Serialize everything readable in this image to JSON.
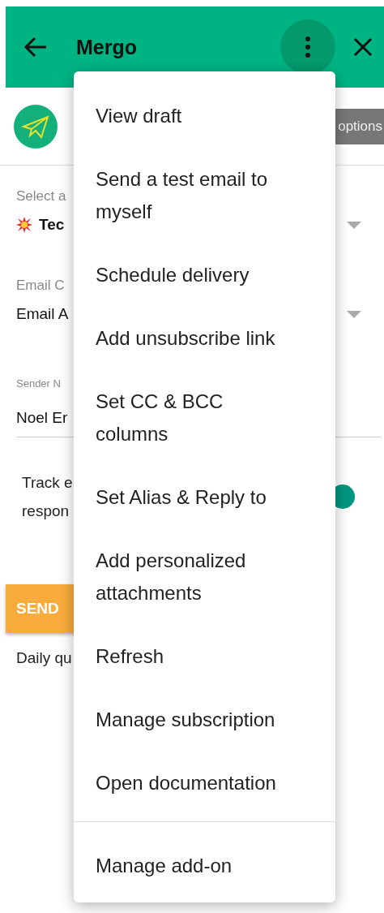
{
  "header": {
    "title": "Mergo"
  },
  "options_button": {
    "label": "options"
  },
  "fields": [
    {
      "kind": "select",
      "label": "Select a",
      "value": "Tec",
      "bold": true
    },
    {
      "kind": "select",
      "label": "Email C",
      "value": "Email A",
      "bold": false
    },
    {
      "kind": "text",
      "label": "Sender N",
      "value": "Noel Er",
      "bold": false
    }
  ],
  "tracking": {
    "lines": [
      "Track e",
      "respon"
    ],
    "on": true
  },
  "send_button": {
    "label": "SEND"
  },
  "quota_text": "Daily qu",
  "menu": {
    "items": [
      {
        "label": "View draft",
        "divider_before": false
      },
      {
        "label": "Send a test email to myself",
        "divider_before": false
      },
      {
        "label": "Schedule delivery",
        "divider_before": false
      },
      {
        "label": "Add unsubscribe link",
        "divider_before": false
      },
      {
        "label": "Set CC & BCC columns",
        "divider_before": false
      },
      {
        "label": "Set Alias & Reply to",
        "divider_before": false
      },
      {
        "label": "Add personalized attachments",
        "divider_before": false
      },
      {
        "label": "Refresh",
        "divider_before": false
      },
      {
        "label": "Manage subscription",
        "divider_before": false
      },
      {
        "label": "Open documentation",
        "divider_before": false
      },
      {
        "label": "Manage add-on",
        "divider_before": true
      }
    ]
  }
}
